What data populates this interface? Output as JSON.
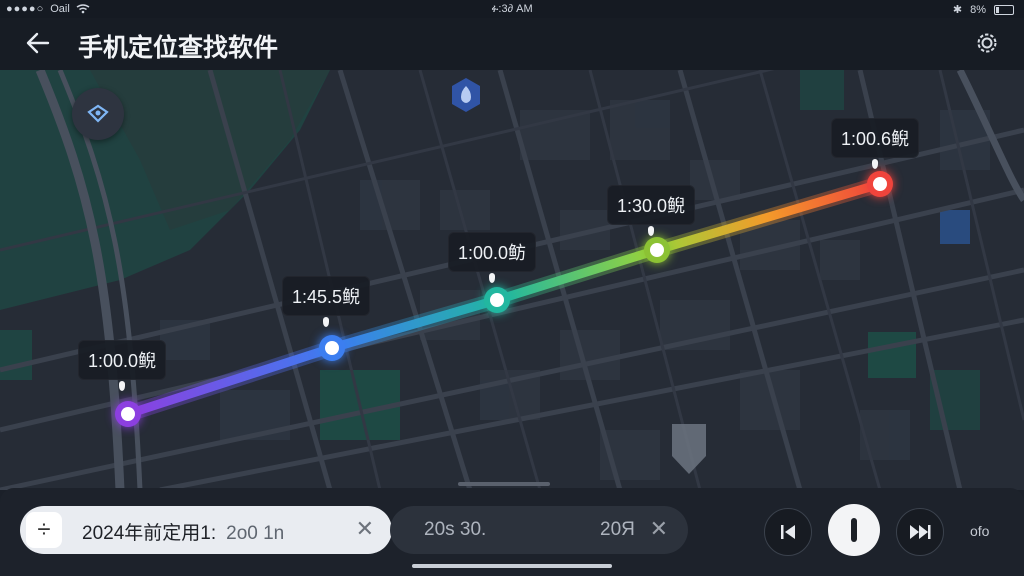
{
  "status_bar": {
    "signal_dots": "●●●●○",
    "carrier": "Oail",
    "time": "ፉ:3∂ AM",
    "battery_text": "8%"
  },
  "header": {
    "title": "手机定位查找软件",
    "back_icon": "back-arrow-icon",
    "settings_icon": "settings-gear-icon"
  },
  "map": {
    "route_gradient": [
      "#8c3fe0",
      "#3c7ef0",
      "#22b7a0",
      "#9bd43a",
      "#f39a2a",
      "#f0443c"
    ],
    "route_points": [
      {
        "label": "1:00.0鲵",
        "color": "#9b4dea"
      },
      {
        "label": "1:45.5鲵",
        "color": "#3b82f6"
      },
      {
        "label": "1:00.0鲂",
        "color": "#14b8a6"
      },
      {
        "label": "1:30.0鲵",
        "color": "#84cc16"
      },
      {
        "label": "1:00.6鲵",
        "color": "#ef4444"
      }
    ]
  },
  "bottom": {
    "search_text": "2024年前定用1:",
    "search_secondary": "2o0 1n",
    "second_a": "20s 30.",
    "second_b": "20Я",
    "close_symbol": "✕",
    "divide_symbol": "÷",
    "more_label": "ofo"
  }
}
